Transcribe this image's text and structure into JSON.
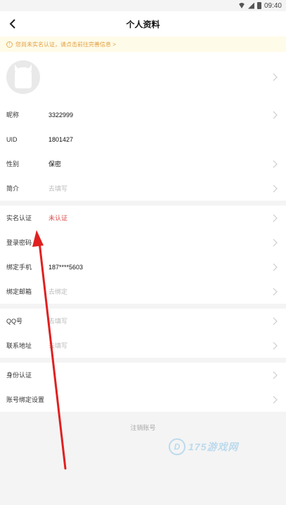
{
  "status_bar": {
    "time": "09:40"
  },
  "header": {
    "title": "个人资料"
  },
  "notice": {
    "text": "您尚未实名认证，请点击前往完善信息 >"
  },
  "profile": {
    "rows": [
      {
        "label": "昵称",
        "value": "3322999"
      },
      {
        "label": "UID",
        "value": "1801427"
      },
      {
        "label": "性别",
        "value": "保密"
      },
      {
        "label": "简介",
        "value": "去填写"
      }
    ]
  },
  "security": {
    "rows": [
      {
        "label": "实名认证",
        "value": "未认证"
      },
      {
        "label": "登录密码",
        "value": ""
      },
      {
        "label": "绑定手机",
        "value": "187****5603"
      },
      {
        "label": "绑定邮箱",
        "value": "去绑定"
      }
    ]
  },
  "contact": {
    "rows": [
      {
        "label": "QQ号",
        "value": "去填写"
      },
      {
        "label": "联系地址",
        "value": "去填写"
      }
    ]
  },
  "other": {
    "rows": [
      {
        "label": "身份认证"
      },
      {
        "label": "账号绑定设置"
      }
    ]
  },
  "footer": {
    "logout_label": "注销账号"
  },
  "watermark": {
    "logo": "D",
    "text": "175游戏网"
  },
  "colors": {
    "accent_red": "#e04848",
    "notice_text": "#e0a040",
    "annotation_arrow": "#e02020"
  }
}
